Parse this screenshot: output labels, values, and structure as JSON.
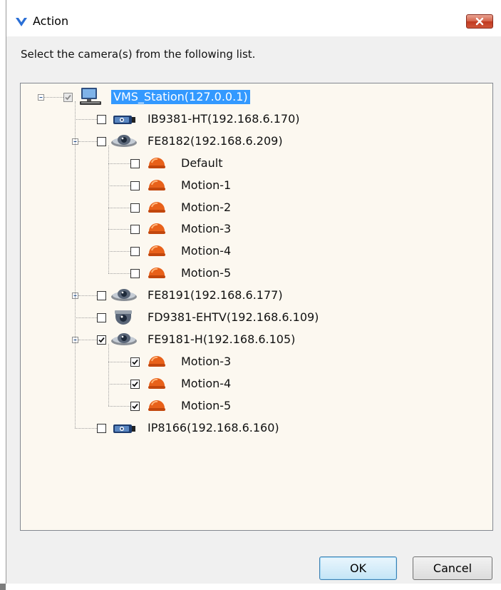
{
  "window": {
    "title": "Action",
    "icon": "app-logo-icon",
    "close_icon": "close-icon"
  },
  "prompt": "Select the camera(s) from the following list.",
  "tree": {
    "root": {
      "label": "VMS_Station(127.0.0.1)",
      "icon": "computer-icon",
      "check_state": "partial",
      "expanded": true,
      "selected": true
    },
    "cameras": [
      {
        "label": "IB9381-HT(192.168.6.170)",
        "icon": "bullet-camera-icon",
        "checked": false,
        "expander": "none"
      },
      {
        "label": "FE8182(192.168.6.209)",
        "icon": "fisheye-camera-icon",
        "checked": false,
        "expander": "minus",
        "children": [
          {
            "label": "Default",
            "icon": "motion-dome-icon",
            "checked": false
          },
          {
            "label": "Motion-1",
            "icon": "motion-dome-icon",
            "checked": false
          },
          {
            "label": "Motion-2",
            "icon": "motion-dome-icon",
            "checked": false
          },
          {
            "label": "Motion-3",
            "icon": "motion-dome-icon",
            "checked": false
          },
          {
            "label": "Motion-4",
            "icon": "motion-dome-icon",
            "checked": false
          },
          {
            "label": "Motion-5",
            "icon": "motion-dome-icon",
            "checked": false
          }
        ]
      },
      {
        "label": "FE8191(192.168.6.177)",
        "icon": "fisheye-camera-icon",
        "checked": false,
        "expander": "plus"
      },
      {
        "label": "FD9381-EHTV(192.168.6.109)",
        "icon": "dome-camera-icon",
        "checked": false,
        "expander": "none"
      },
      {
        "label": "FE9181-H(192.168.6.105)",
        "icon": "fisheye-camera-icon",
        "checked": true,
        "expander": "minus",
        "children": [
          {
            "label": "Motion-3",
            "icon": "motion-dome-icon",
            "checked": true
          },
          {
            "label": "Motion-4",
            "icon": "motion-dome-icon",
            "checked": true
          },
          {
            "label": "Motion-5",
            "icon": "motion-dome-icon",
            "checked": true
          }
        ]
      },
      {
        "label": "IP8166(192.168.6.160)",
        "icon": "bullet-camera-icon",
        "checked": false,
        "expander": "none"
      }
    ]
  },
  "buttons": {
    "ok": "OK",
    "cancel": "Cancel"
  },
  "colors": {
    "selection": "#3399ff",
    "tree_background": "#fcf8f0",
    "motion_icon": "#e8611a"
  }
}
